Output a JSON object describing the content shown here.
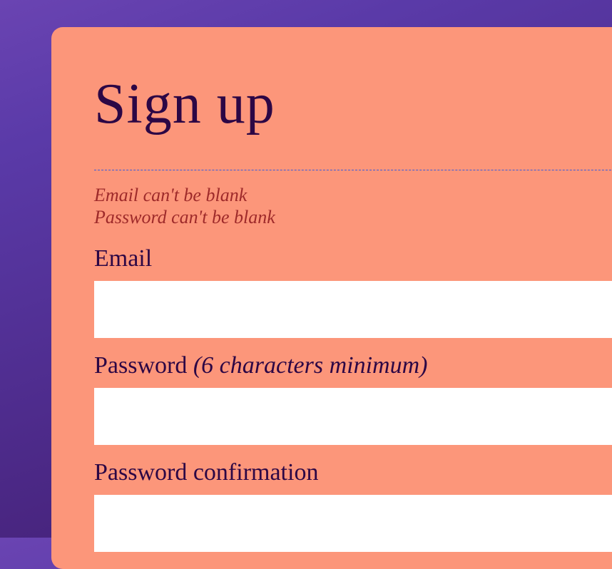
{
  "title": "Sign up",
  "errors": [
    "Email can't be blank",
    "Password can't be blank"
  ],
  "fields": {
    "email": {
      "label": "Email",
      "value": ""
    },
    "password": {
      "label": "Password",
      "hint": "(6 characters minimum)",
      "value": ""
    },
    "password_confirmation": {
      "label": "Password confirmation",
      "value": ""
    }
  }
}
